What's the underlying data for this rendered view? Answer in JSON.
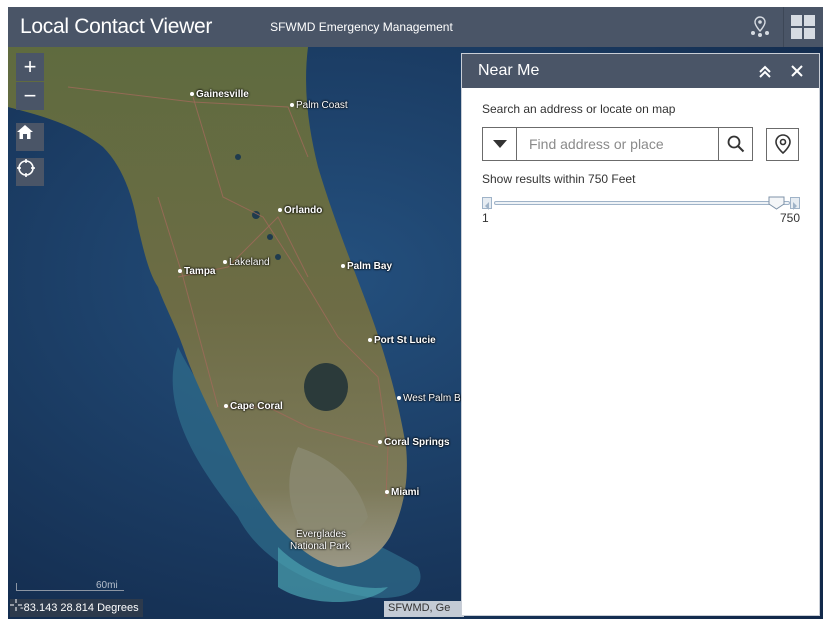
{
  "header": {
    "title": "Local Contact Viewer",
    "subtitle": "SFWMD Emergency Management",
    "locate_icon": "map-pin-people-icon",
    "menu_icon": "grid-icon"
  },
  "map": {
    "controls": {
      "zoom_in": "+",
      "zoom_out": "−",
      "home_icon": "home-icon",
      "locate_icon": "crosshair-icon"
    },
    "cities": [
      {
        "name": "Gainesville",
        "bold": true
      },
      {
        "name": "Palm Coast",
        "bold": false
      },
      {
        "name": "Orlando",
        "bold": true
      },
      {
        "name": "Lakeland",
        "bold": false
      },
      {
        "name": "Tampa",
        "bold": true
      },
      {
        "name": "Palm Bay",
        "bold": true
      },
      {
        "name": "Port St Lucie",
        "bold": true
      },
      {
        "name": "West Palm Be",
        "bold": false
      },
      {
        "name": "Cape Coral",
        "bold": true
      },
      {
        "name": "Coral Springs",
        "bold": true
      },
      {
        "name": "Miami",
        "bold": true
      },
      {
        "name": "Everglades",
        "bold": false
      },
      {
        "name": "National Park",
        "bold": false
      }
    ],
    "scale_label": "60mi",
    "coordinates": "-83.143 28.814 Degrees",
    "attribution": "SFWMD, Ge"
  },
  "panel": {
    "title": "Near Me",
    "help_text": "Search an address or locate on map",
    "search": {
      "placeholder": "Find address or place",
      "value": ""
    },
    "range_text": "Show results within 750 Feet",
    "slider": {
      "min": "1",
      "max": "750",
      "value": 750
    }
  },
  "colors": {
    "header": "#4a5567",
    "panel_border": "#c9ced6"
  }
}
